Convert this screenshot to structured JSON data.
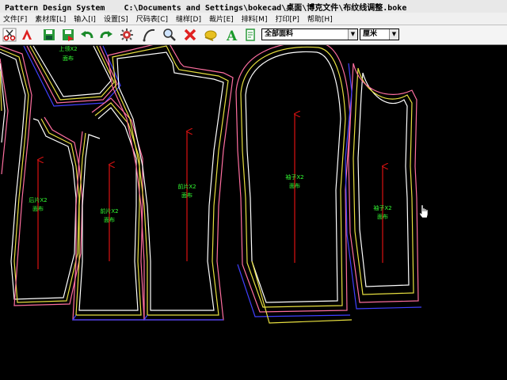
{
  "window": {
    "title": "Pattern Design System    C:\\Documents and Settings\\bokecad\\桌面\\博克文件\\布纹线调整.boke"
  },
  "menu": [
    "文件[F]",
    "素材库[L]",
    "输入[I]",
    "设置[S]",
    "尺码表[C]",
    "缝样[D]",
    "裁片[E]",
    "排料[M]",
    "打印[P]",
    "帮助[H]"
  ],
  "toolbar": {
    "tools": [
      "scissors-icon",
      "pen-shape-icon",
      "save-icon",
      "save-as-icon",
      "undo-icon",
      "redo-icon",
      "gear-tool-icon",
      "curve-tool-icon",
      "zoom-icon",
      "delete-icon",
      "measure-tape-icon",
      "text-icon",
      "piece-info-icon"
    ],
    "fabric_select": "全部面料",
    "unit_select": "厘米"
  },
  "pieces": [
    {
      "name": "上领X2",
      "fabric": "面布"
    },
    {
      "name": "后片X2",
      "fabric": "面布"
    },
    {
      "name": "前片X2",
      "fabric": "面布"
    },
    {
      "name": "前片X2",
      "fabric": "面布"
    },
    {
      "name": "袖子X2",
      "fabric": "面布"
    },
    {
      "name": "袖子X2",
      "fabric": "面布"
    }
  ],
  "colors": {
    "seam_white": "#ffffff",
    "seam_yellow": "#e8e040",
    "seam_pink": "#ff6fa0",
    "seam_blue": "#4040ff",
    "grain_arrow": "#cc1010",
    "label": "#33ff33"
  }
}
